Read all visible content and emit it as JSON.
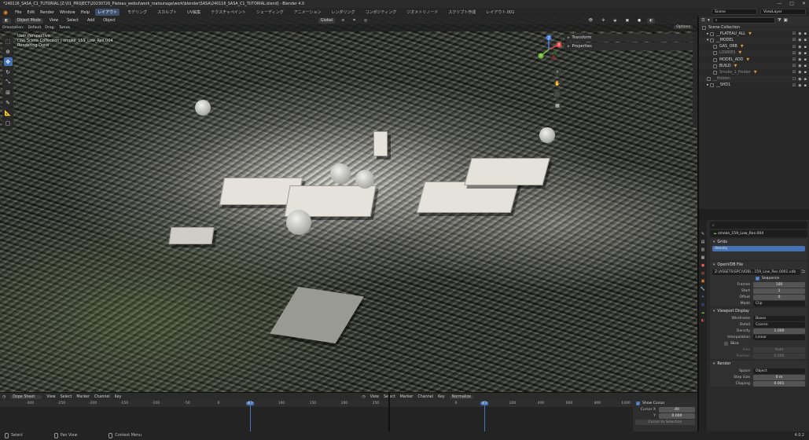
{
  "window": {
    "title": "*240116_SASA_C1_TUTORIAL [Z:\\01_PROJECT\\20230726_Plateau_webui\\work_matsunaga\\work\\blender\\SASA\\240116_SASA_C1_TUTORIAL.blend] - Blender 4.0",
    "controls": [
      "—",
      "□",
      "✕"
    ]
  },
  "menubar": {
    "menus": [
      "File",
      "Edit",
      "Render",
      "Window",
      "Help"
    ],
    "workspaces": [
      "レイアウト",
      "モデリング",
      "スカルプト",
      "UV編集",
      "テクスチャペイント",
      "シェーディング",
      "アニメーション",
      "レンダリング",
      "コンポジティング",
      "ジオメトリノード",
      "スクリプト作成",
      "レイアウト.001"
    ],
    "active_workspace": "レイアウト",
    "scene": "Scene",
    "view_layer": "ViewLayer"
  },
  "viewport": {
    "header": [
      "Object Mode",
      "View",
      "Select",
      "Add",
      "Object"
    ],
    "transform_orientation": "Global",
    "tool_header": [
      "Orientation:",
      "Default",
      "Drag:",
      "Tweak"
    ],
    "options_label": "Options",
    "overlay_lines": [
      "User Perspective",
      "(39) Scene Collection | smoke_159_Low_Res.004",
      "Rendering Done"
    ],
    "npanel": [
      "Transform",
      "Properties"
    ],
    "gizmo_axes": [
      "X",
      "Y",
      "Z"
    ]
  },
  "outliner": {
    "header_label": "Scene Collection",
    "rows": [
      {
        "label": "Scene Collection",
        "depth": 0
      },
      {
        "label": "__PLATEAU_ALL",
        "depth": 1
      },
      {
        "label": "__MODEL",
        "depth": 1
      },
      {
        "label": "GAS_ORB",
        "depth": 2
      },
      {
        "label": "LOWRES",
        "depth": 2
      },
      {
        "label": "MODEL_ADD",
        "depth": 2
      },
      {
        "label": "BUILD",
        "depth": 2
      },
      {
        "label": "Smoke_1_Holder",
        "depth": 2
      },
      {
        "label": "__Hidden",
        "depth": 1
      },
      {
        "label": "__SHD1",
        "depth": 1
      }
    ]
  },
  "properties": {
    "search_placeholder": "",
    "object_name": "smoke_159_Low_Res.004",
    "grids_title": "Grids",
    "grid_selected": "density",
    "openvdb_title": "OpenVDB File",
    "openvdb_path": "Z:\\ASSETS\\SPC\\VDB\\...159_Low_Res.0001.vdb",
    "sequence_label": "Sequence",
    "frames": {
      "label": "Frames",
      "value": "100"
    },
    "start": {
      "label": "Start",
      "value": "1"
    },
    "offset": {
      "label": "Offset",
      "value": "0"
    },
    "mode": {
      "label": "Mode",
      "value": "Clip"
    },
    "viewport_display_title": "Viewport Display",
    "wireframe": {
      "label": "Wireframe",
      "value": "Boxes"
    },
    "detail": {
      "label": "Detail",
      "value": "Coarse"
    },
    "density": {
      "label": "Density",
      "value": "1.000"
    },
    "interpolation": {
      "label": "Interpolation",
      "value": "Linear"
    },
    "slice_label": "Slice",
    "axis": {
      "label": "Axis",
      "value": "Auto"
    },
    "position": {
      "label": "Position",
      "value": "0.500"
    },
    "render_title": "Render",
    "space": {
      "label": "Space",
      "value": "Object"
    },
    "step_size": {
      "label": "Step Size",
      "value": "0 m"
    },
    "clipping": {
      "label": "Clipping",
      "value": "0.001"
    }
  },
  "timeline": {
    "editor": "Dope Sheet",
    "menus": [
      "View",
      "Select",
      "Marker",
      "Channel",
      "Key"
    ],
    "ruler": [
      "-300",
      "-250",
      "-200",
      "-150",
      "-100",
      "-50",
      "0",
      "40",
      "100",
      "150",
      "200",
      "250"
    ],
    "current_frame": "40",
    "graph_menus": [
      "View",
      "Select",
      "Marker",
      "Channel",
      "Key"
    ],
    "normalize": "Normalize",
    "graph_ruler": [
      "0",
      "40",
      "200",
      "400",
      "600",
      "800",
      "1000"
    ],
    "show_cursor": "Show Cursor",
    "cursor_x": {
      "label": "Cursor X",
      "value": "40"
    },
    "cursor_y": {
      "label": "Y",
      "value": "0.000"
    },
    "cursor_to_selection": "Cursor to Selection"
  },
  "statusbar": {
    "items": [
      "Select",
      "Pan View",
      "Context Menu"
    ],
    "version": "4.0.2"
  },
  "colors": {
    "accent": "#4772b3",
    "brand": "#e98a2a"
  }
}
